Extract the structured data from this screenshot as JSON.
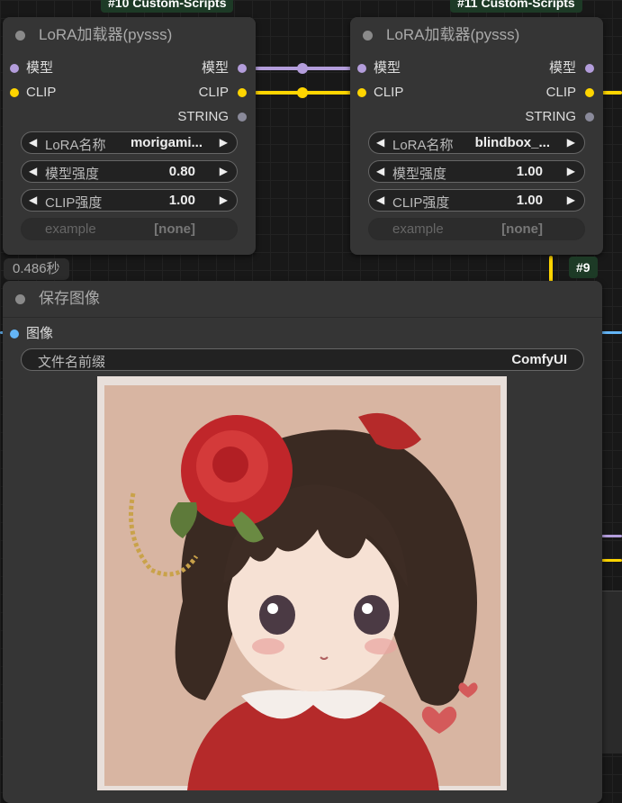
{
  "tags": {
    "node10": "#10 Custom-Scripts",
    "node11": "#11 Custom-Scripts",
    "node9": "#9"
  },
  "lora_node_1": {
    "title": "LoRA加载器(pysss)",
    "inputs": [
      "模型",
      "CLIP"
    ],
    "outputs": [
      "模型",
      "CLIP",
      "STRING"
    ],
    "widgets": [
      {
        "label": "LoRA名称",
        "value": "morigami..."
      },
      {
        "label": "模型强度",
        "value": "0.80"
      },
      {
        "label": "CLIP强度",
        "value": "1.00"
      }
    ],
    "disabled_widget": {
      "label": "example",
      "value": "[none]"
    }
  },
  "lora_node_2": {
    "title": "LoRA加载器(pysss)",
    "inputs": [
      "模型",
      "CLIP"
    ],
    "outputs": [
      "模型",
      "CLIP",
      "STRING"
    ],
    "widgets": [
      {
        "label": "LoRA名称",
        "value": "blindbox_..."
      },
      {
        "label": "模型强度",
        "value": "1.00"
      },
      {
        "label": "CLIP强度",
        "value": "1.00"
      }
    ],
    "disabled_widget": {
      "label": "example",
      "value": "[none]"
    }
  },
  "timer": "0.486秒",
  "save_node": {
    "title": "保存图像",
    "input": "图像",
    "widget": {
      "label": "文件名前缀",
      "value": "ComfyUI"
    }
  },
  "colors": {
    "model_slot": "#b39ddb",
    "clip_slot": "#ffd500",
    "string_slot": "#8a8a9a",
    "image_slot": "#64b5f6",
    "tag_bg": "#1d3a26"
  }
}
